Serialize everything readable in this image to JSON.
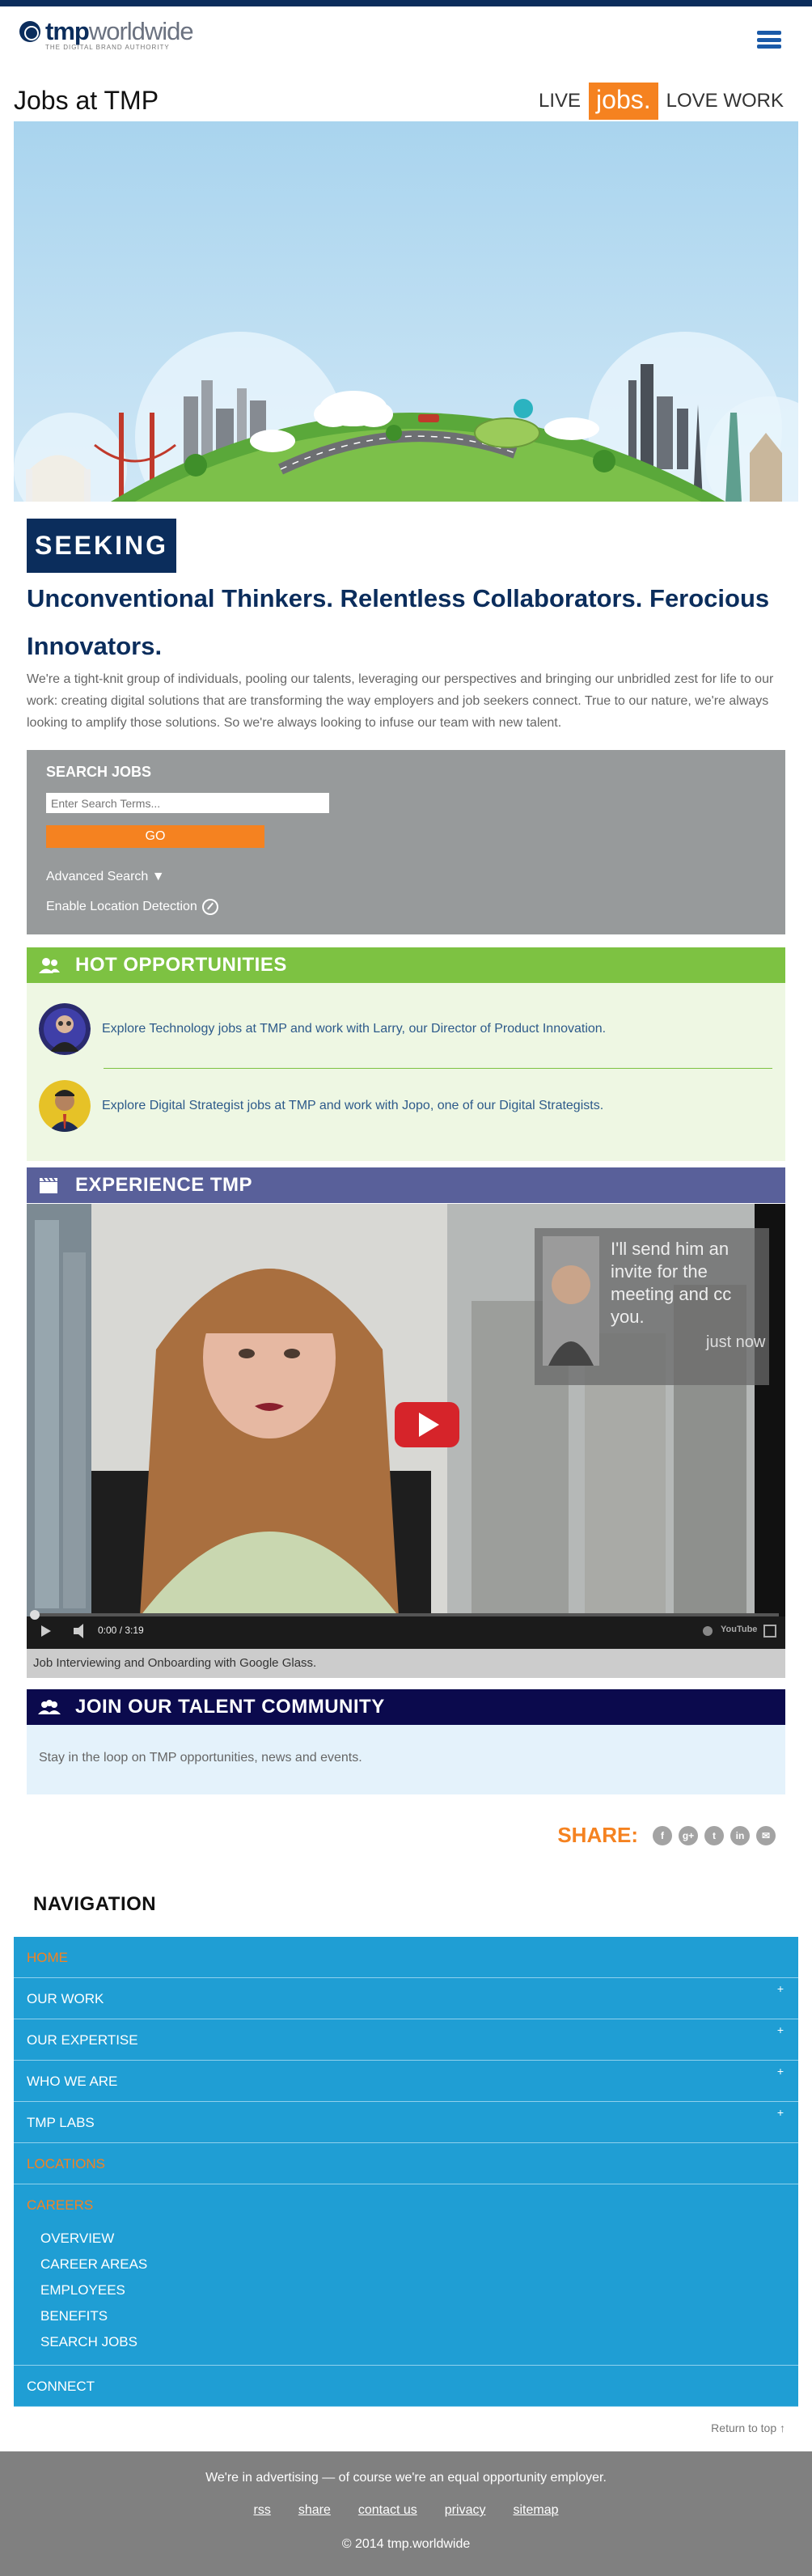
{
  "header": {
    "logo_bold": "tmp",
    "logo_light": "worldwide",
    "logo_tagline": "THE DIGITAL BRAND AUTHORITY",
    "menu_icon": "hamburger-icon"
  },
  "page": {
    "title": "Jobs at TMP",
    "slogan_live": "LIVE",
    "slogan_jobs": "jobs.",
    "slogan_love": "LOVE WORK"
  },
  "intro": {
    "badge": "SEEKING",
    "headline": "Unconventional Thinkers. Relentless Collaborators. Ferocious Innovators.",
    "body": "We're a tight-knit group of individuals, pooling our talents, leveraging our perspectives and bringing our unbridled zest for life to our work: creating digital solutions that are transforming the way employers and job seekers connect. True to our nature, we're always looking to amplify those solutions. So we're always looking to infuse our team with new talent."
  },
  "search": {
    "title": "SEARCH JOBS",
    "placeholder": "Enter Search Terms...",
    "go_label": "GO",
    "advanced_label": "Advanced Search ▼",
    "location_label": "Enable Location Detection"
  },
  "hot": {
    "title": "HOT OPPORTUNITIES",
    "items": [
      {
        "text": "Explore Technology jobs at TMP and work with Larry, our Director of Product Innovation."
      },
      {
        "text": "Explore Digital Strategist jobs at TMP and work with Jopo, one of our Digital Strategists."
      }
    ]
  },
  "experience": {
    "title": "EXPERIENCE TMP",
    "overlay_text": "I'll send him an invite for the meeting and cc you.",
    "overlay_time": "just now",
    "time": "0:00 / 3:19",
    "brand": "YouTube",
    "caption": "Job Interviewing and Onboarding with Google Glass.",
    "progress": 0
  },
  "talent": {
    "title": "JOIN OUR TALENT COMMUNITY",
    "body": "Stay in the loop on TMP opportunities, news and events."
  },
  "share": {
    "label": "SHARE:",
    "icons": [
      {
        "name": "facebook-icon",
        "glyph": "f"
      },
      {
        "name": "googleplus-icon",
        "glyph": "g+"
      },
      {
        "name": "twitter-icon",
        "glyph": "t"
      },
      {
        "name": "linkedin-icon",
        "glyph": "in"
      },
      {
        "name": "email-icon",
        "glyph": "✉"
      }
    ]
  },
  "navigation": {
    "title": "NAVIGATION",
    "home": "HOME",
    "our_work": "OUR WORK",
    "our_expertise": "OUR EXPERTISE",
    "who_we_are": "WHO WE ARE",
    "tmp_labs": "TMP LABS",
    "locations": "LOCATIONS",
    "careers": "CAREERS",
    "careers_sub": [
      "OVERVIEW",
      "CAREER AREAS",
      "EMPLOYEES",
      "BENEFITS",
      "SEARCH JOBS"
    ],
    "connect": "CONNECT",
    "plus": "+",
    "return_top": "Return to top ↑"
  },
  "footer": {
    "statement": "We're in advertising — of course we're an equal opportunity employer.",
    "links": [
      "rss",
      "share",
      "contact us",
      "privacy",
      "sitemap"
    ],
    "copyright": "© 2014 tmp.worldwide"
  },
  "colors": {
    "navy": "#0b2d5c",
    "orange": "#f58220",
    "green": "#7dc242",
    "purple": "#59609a",
    "dark_navy": "#0b0a4d",
    "nav_blue": "#1f9ed4"
  }
}
